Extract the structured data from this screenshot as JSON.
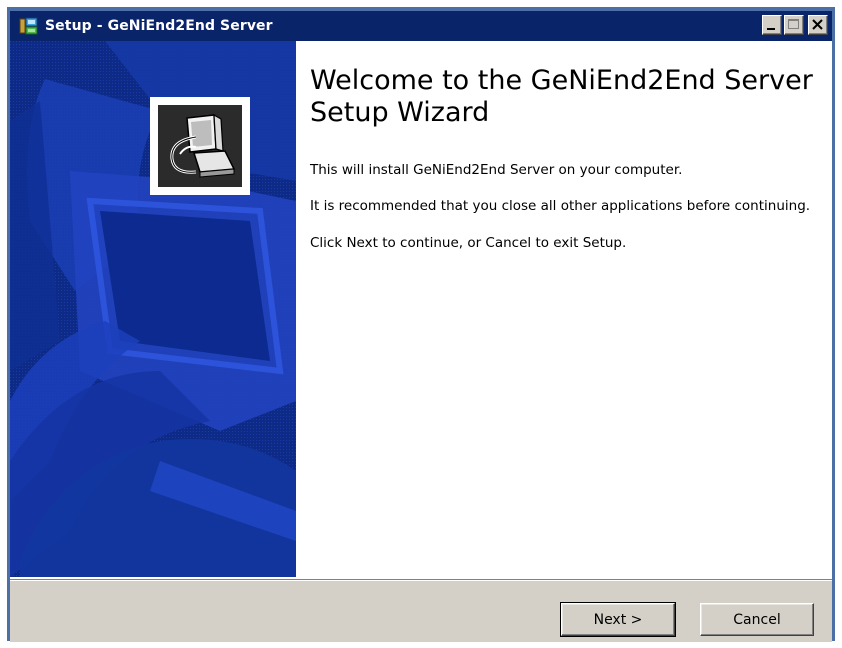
{
  "window": {
    "title": "Setup - GeNiEnd2End Server",
    "title_icon": "setup-installer-icon"
  },
  "title_buttons": {
    "minimize_icon": "minimize-icon",
    "maximize_icon": "maximize-icon",
    "close_icon": "close-icon"
  },
  "side_panel": {
    "icon": "computer-setup-icon"
  },
  "main": {
    "heading": "Welcome to the GeNiEnd2End Server Setup Wizard",
    "paragraphs": [
      "This will install GeNiEnd2End Server on your computer.",
      "It is recommended that you close all other applications before continuing.",
      "Click Next to continue, or Cancel to exit Setup."
    ]
  },
  "buttons": {
    "next_label": "Next >",
    "cancel_label": "Cancel"
  },
  "colors": {
    "titlebar": "#0a246a",
    "side_panel_dark": "#0d2a86",
    "side_panel_light": "#2a4fd8",
    "dialog_face": "#d4d0c8"
  }
}
